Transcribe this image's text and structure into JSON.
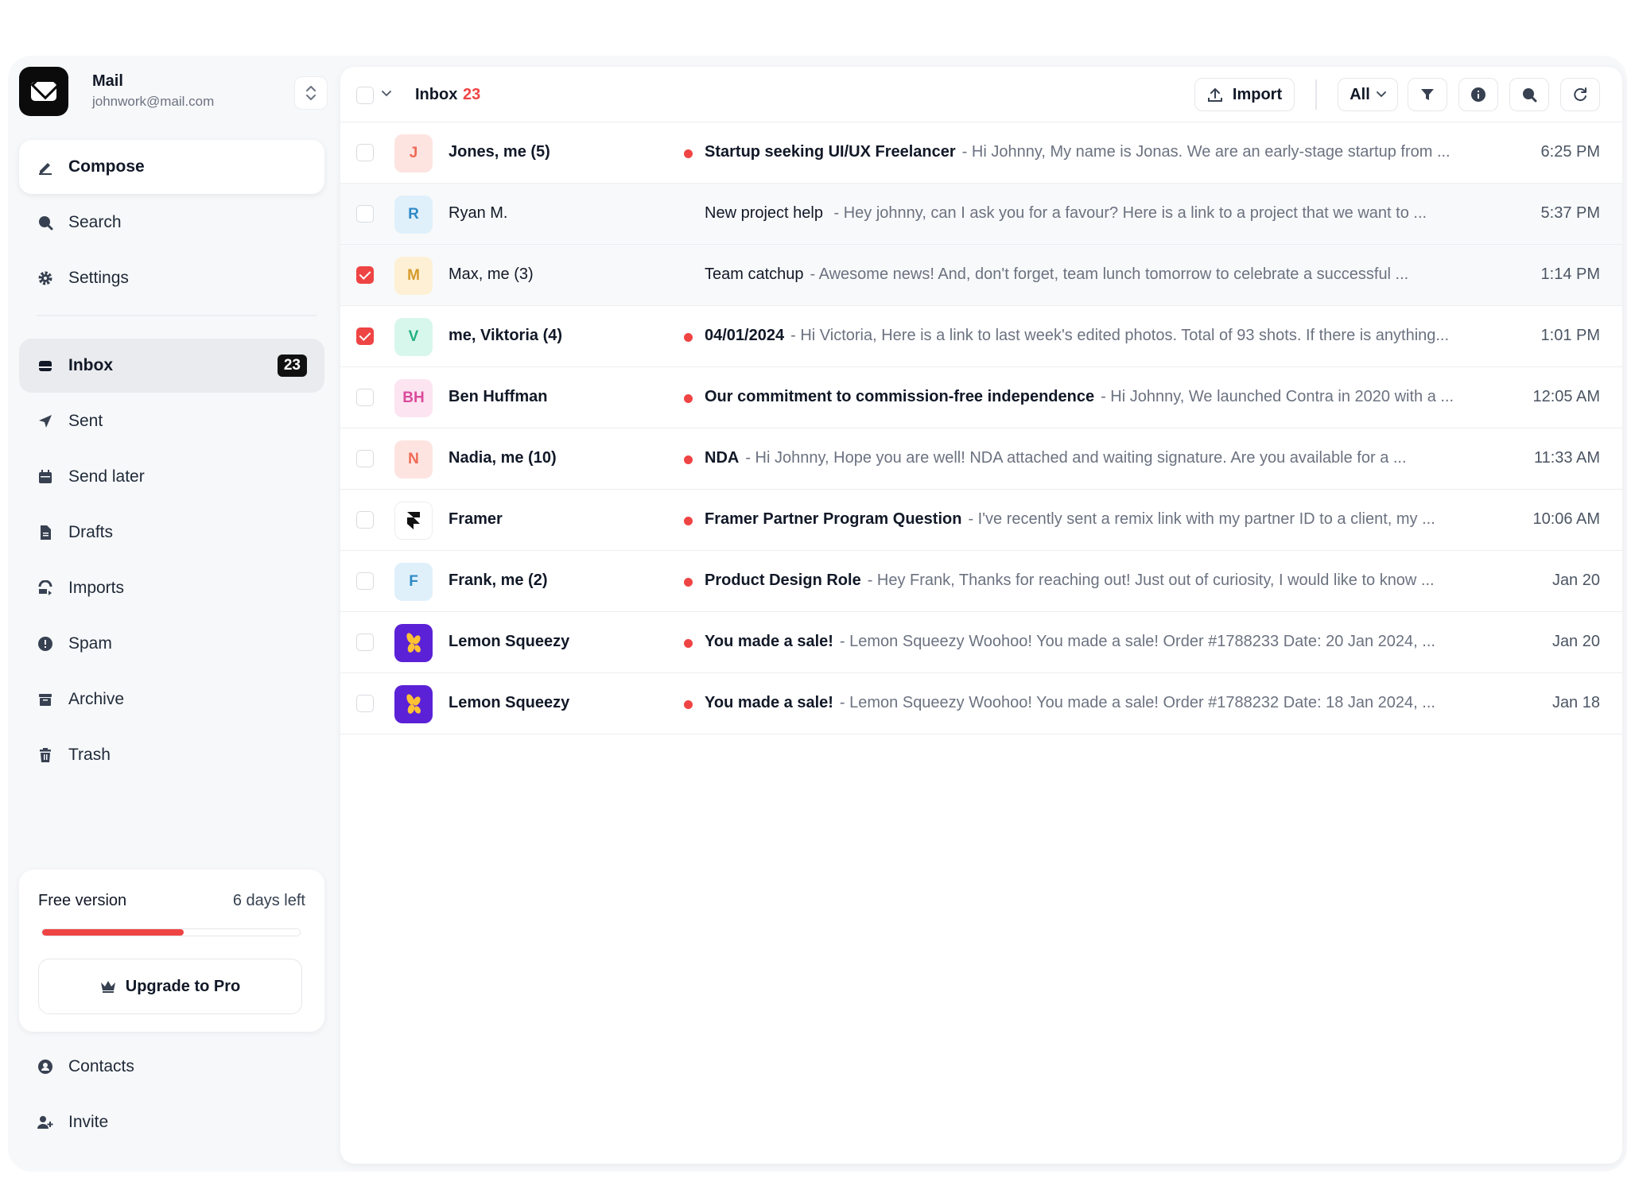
{
  "account": {
    "name": "Mail",
    "email": "johnwork@mail.com"
  },
  "nav": {
    "compose": "Compose",
    "search": "Search",
    "settings": "Settings",
    "inbox": "Inbox",
    "inbox_count": "23",
    "sent": "Sent",
    "send_later": "Send later",
    "drafts": "Drafts",
    "imports": "Imports",
    "spam": "Spam",
    "archive": "Archive",
    "trash": "Trash",
    "contacts": "Contacts",
    "invite": "Invite"
  },
  "trial": {
    "label": "Free version",
    "days_left": "6 days left",
    "progress": 0.55,
    "upgrade_label": "Upgrade to Pro"
  },
  "toolbar": {
    "title": "Inbox",
    "count": "23",
    "import_label": "Import",
    "filter_label": "All"
  },
  "colors": {
    "accent": "#ef4444",
    "text": "#111827",
    "muted": "#6b7280"
  },
  "emails": [
    {
      "checked": false,
      "unread": true,
      "avatar": "J",
      "avatar_bg": "#fde4e1",
      "avatar_fg": "#ef6a55",
      "sender": "Jones, me (5)",
      "subject": "Startup seeking UI/UX Freelancer",
      "preview": "- Hi Johnny, My name is Jonas. We are an early-stage startup from ...",
      "time": "6:25 PM"
    },
    {
      "checked": false,
      "unread": false,
      "avatar": "R",
      "avatar_bg": "#dff0fb",
      "avatar_fg": "#2f8ac4",
      "sender": "Ryan M.",
      "subject": "New project help",
      "preview": " -  Hey johnny, can I ask you for a favour? Here is a link to a project that we want to ...",
      "time": "5:37 PM"
    },
    {
      "checked": true,
      "unread": false,
      "avatar": "M",
      "avatar_bg": "#fdf0d5",
      "avatar_fg": "#d59a2a",
      "sender": "Max, me (3)",
      "subject": "Team catchup",
      "preview": "- Awesome news! And, don't forget, team lunch tomorrow to celebrate a successful ...",
      "time": "1:14 PM"
    },
    {
      "checked": true,
      "unread": true,
      "avatar": "V",
      "avatar_bg": "#d8f7ec",
      "avatar_fg": "#23b07f",
      "sender": "me, Viktoria (4)",
      "subject": "04/01/2024",
      "preview": "- Hi Victoria, Here is a link to last week's edited photos. Total of 93 shots. If there is anything...",
      "time": "1:01 PM"
    },
    {
      "checked": false,
      "unread": true,
      "avatar": "BH",
      "avatar_bg": "#fce4f1",
      "avatar_fg": "#db4a9b",
      "sender": "Ben Huffman",
      "subject": "Our commitment to commission-free independence",
      "preview": "- Hi Johnny, We launched Contra in 2020 with a ...",
      "time": "12:05 AM"
    },
    {
      "checked": false,
      "unread": true,
      "avatar": "N",
      "avatar_bg": "#fde4e1",
      "avatar_fg": "#ef6a55",
      "sender": "Nadia, me (10)",
      "subject": "NDA",
      "preview": "- Hi Johnny, Hope you are well! NDA attached and waiting signature. Are you available for a ...",
      "time": "11:33 AM"
    },
    {
      "checked": false,
      "unread": true,
      "avatar": "framer",
      "avatar_bg": "#ffffff",
      "avatar_fg": "#111111",
      "sender": "Framer",
      "subject": "Framer Partner Program Question",
      "preview": "- I've recently sent a remix link with my partner ID to a client, my ...",
      "time": "10:06 AM"
    },
    {
      "checked": false,
      "unread": true,
      "avatar": "F",
      "avatar_bg": "#dff0fb",
      "avatar_fg": "#2f8ac4",
      "sender": "Frank, me (2)",
      "subject": "Product Design Role",
      "preview": "- Hey Frank, Thanks for reaching out! Just out of curiosity, I would like to know ...",
      "time": "Jan 20"
    },
    {
      "checked": false,
      "unread": true,
      "avatar": "lemon",
      "avatar_bg": "#5b21d6",
      "avatar_fg": "#ffc233",
      "sender": "Lemon Squeezy",
      "subject": "You made a sale!",
      "preview": "- Lemon Squeezy Woohoo! You made a sale! Order #1788233 Date: 20 Jan 2024, ...",
      "time": "Jan 20"
    },
    {
      "checked": false,
      "unread": true,
      "avatar": "lemon",
      "avatar_bg": "#5b21d6",
      "avatar_fg": "#ffc233",
      "sender": "Lemon Squeezy",
      "subject": "You made a sale!",
      "preview": "- Lemon Squeezy Woohoo! You made a sale! Order #1788232 Date: 18 Jan 2024, ...",
      "time": "Jan 18"
    }
  ]
}
